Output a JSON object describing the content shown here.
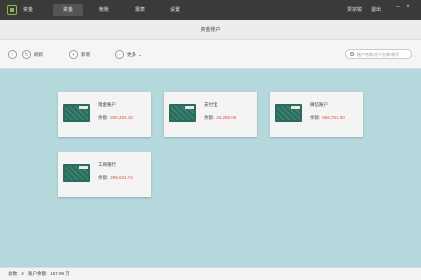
{
  "topbar": {
    "tabs": [
      "资金",
      "资金",
      "帐账",
      "报表",
      "设置"
    ],
    "active_tab": 1,
    "user": "贾宗锐",
    "exit": "退出"
  },
  "window_title": "资金账户",
  "toolbar": {
    "refresh_label": "刷新",
    "add_label": "新增",
    "more_label": "更多",
    "search_placeholder": "账户名称/开户名称/账号"
  },
  "accounts": [
    {
      "name": "现金账户",
      "balance_label": "余额:",
      "balance": "930,493.15"
    },
    {
      "name": "支付宝",
      "balance_label": "余额:",
      "balance": "33,295.06"
    },
    {
      "name": "微信账户",
      "balance_label": "余额:",
      "balance": "866,761.00"
    },
    {
      "name": "工商银行",
      "balance_label": "余额:",
      "balance": "299,641.74"
    }
  ],
  "status": {
    "count_label": "总数:",
    "count": "4",
    "total_label": "账户余额:",
    "total": "157.99 万"
  },
  "colors": {
    "accent_red": "#e0533d",
    "main_bg": "#b5d8dc",
    "topbar_bg": "#3a3a3a"
  }
}
